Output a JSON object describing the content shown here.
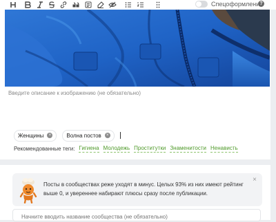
{
  "toolbar": {
    "buttons": [
      "heading-icon",
      "bold-icon",
      "italic-icon",
      "strikethrough-icon",
      "link-icon",
      "quote-icon",
      "code-block-icon",
      "highlight-icon",
      "spoiler-icon",
      "bullet-list-icon",
      "numbered-list-icon",
      "drag-handle-icon"
    ],
    "spec_label": "Спецоформление",
    "spec_enabled": false,
    "help_label": "?"
  },
  "image_block": {
    "caption_placeholder": "Введите описание к изображению (не обязательно)"
  },
  "tags": {
    "items": [
      "Женщины",
      "Волна постов"
    ],
    "remove_label": "×",
    "recommended_label": "Рекомендованные теги:",
    "recommended": [
      "Гигиена",
      "Молодежь",
      "Проститутки",
      "Знаменитости",
      "Ненависть"
    ]
  },
  "notice": {
    "text": "Посты в сообществах реже уходят в минус. Целых 93% из них имеют рейтинг выше 0, и увереннее набирают плюсы сразу после публикации.",
    "close_label": "×"
  },
  "community": {
    "placeholder": "Начните вводить название сообщества (не обязательно)"
  },
  "colors": {
    "accent_green": "#4f9a2a",
    "jacket_blue": "#1f63c6",
    "page_bg": "#eceef1"
  }
}
